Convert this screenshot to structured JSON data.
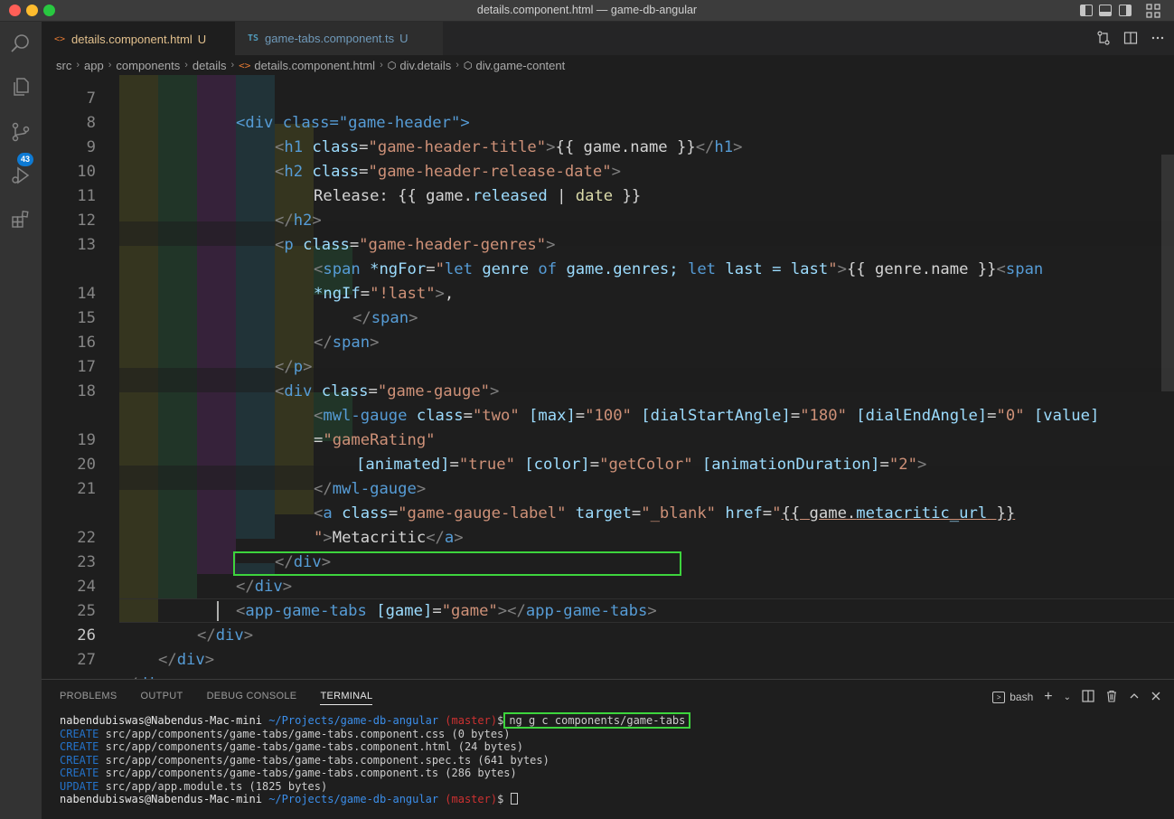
{
  "window": {
    "title": "details.component.html — game-db-angular"
  },
  "activity": {
    "scm_badge": "43"
  },
  "tabs": [
    {
      "icon": "<>",
      "label": "details.component.html",
      "status": "U"
    },
    {
      "icon": "TS",
      "label": "game-tabs.component.ts",
      "status": "U"
    }
  ],
  "breadcrumb": [
    "src",
    "app",
    "components",
    "details",
    "details.component.html",
    "div.details",
    "div.game-content"
  ],
  "editor": {
    "lines": [
      {
        "n": "7"
      },
      {
        "n": "8"
      },
      {
        "n": "9"
      },
      {
        "n": "10"
      },
      {
        "n": "11"
      },
      {
        "n": "12"
      },
      {
        "n": "13"
      },
      {
        "n": ""
      },
      {
        "n": "14"
      },
      {
        "n": "15"
      },
      {
        "n": "16"
      },
      {
        "n": "17"
      },
      {
        "n": "18"
      },
      {
        "n": ""
      },
      {
        "n": "19"
      },
      {
        "n": "20"
      },
      {
        "n": "21"
      },
      {
        "n": ""
      },
      {
        "n": "22"
      },
      {
        "n": "23"
      },
      {
        "n": "24"
      },
      {
        "n": "25"
      },
      {
        "n": "26"
      },
      {
        "n": "27"
      }
    ],
    "tokens": {
      "l7": [
        "<div class=\"game-header\">"
      ],
      "l8": [
        "<",
        "h1",
        " class",
        "=",
        "\"game-header-title\"",
        ">",
        "{{ game.name }}",
        "</",
        "h1",
        ">"
      ],
      "l9": [
        "<",
        "h2",
        " class",
        "=",
        "\"game-header-release-date\"",
        ">"
      ],
      "l10": [
        "Release: {{ game.",
        "released",
        " | ",
        "date",
        " }}"
      ],
      "l11": [
        "</",
        "h2",
        ">"
      ],
      "l12": [
        "<",
        "p",
        " class",
        "=",
        "\"game-header-genres\"",
        ">"
      ],
      "l13": [
        "<",
        "span",
        " *ngFor",
        "=",
        "\"",
        "let",
        " genre ",
        "of",
        " game.genres; ",
        "let",
        " last = last",
        "\"",
        ">",
        "{{ genre.name }}",
        "<",
        "span"
      ],
      "l13b": [
        "*ngIf",
        "=",
        "\"!last\"",
        ">",
        ","
      ],
      "l14": [
        "</",
        "span",
        ">"
      ],
      "l15": [
        "</",
        "span",
        ">"
      ],
      "l16": [
        "</",
        "p",
        ">"
      ],
      "l17": [
        "<",
        "div",
        " class",
        "=",
        "\"game-gauge\"",
        ">"
      ],
      "l18": [
        "<",
        "mwl-gauge",
        " class",
        "=",
        "\"two\"",
        " [max]",
        "=",
        "\"100\"",
        " [dialStartAngle]",
        "=",
        "\"180\"",
        " [dialEndAngle]",
        "=",
        "\"0\"",
        " [value]"
      ],
      "l18b": [
        "=",
        "\"gameRating\""
      ],
      "l19": [
        "[animated]",
        "=",
        "\"true\"",
        " [color]",
        "=",
        "\"getColor\"",
        " [animationDuration]",
        "=",
        "\"2\"",
        ">"
      ],
      "l20": [
        "</",
        "mwl-gauge",
        ">"
      ],
      "l21": [
        "<",
        "a",
        " class",
        "=",
        "\"game-gauge-label\"",
        " target",
        "=",
        "\"_blank\"",
        " href",
        "=",
        "\"",
        "{{ game.",
        "metacritic_url",
        " }}"
      ],
      "l21b": [
        "\"",
        ">",
        "Metacritic",
        "</",
        "a",
        ">"
      ],
      "l22": [
        "</",
        "div",
        ">"
      ],
      "l23": [
        "</",
        "div",
        ">"
      ],
      "l24": [
        "<",
        "app-game-tabs",
        " [game]",
        "=",
        "\"game\"",
        "></",
        "app-game-tabs",
        ">"
      ],
      "l25": [
        "</",
        "div",
        ">"
      ],
      "l26": [
        "</",
        "div",
        ">"
      ],
      "l27": [
        "</",
        "div",
        ">"
      ]
    }
  },
  "panel": {
    "tabs": [
      "PROBLEMS",
      "OUTPUT",
      "DEBUG CONSOLE",
      "TERMINAL"
    ],
    "shell": "bash",
    "terminal": {
      "user": "nabendubiswas@Nabendus-Mac-mini",
      "path": "~/Projects/game-db-angular",
      "branch": "(master)",
      "prompt_end": "$",
      "command": "ng g c components/game-tabs",
      "output": [
        {
          "action": "CREATE",
          "text": " src/app/components/game-tabs/game-tabs.component.css (0 bytes)"
        },
        {
          "action": "CREATE",
          "text": " src/app/components/game-tabs/game-tabs.component.html (24 bytes)"
        },
        {
          "action": "CREATE",
          "text": " src/app/components/game-tabs/game-tabs.component.spec.ts (641 bytes)"
        },
        {
          "action": "CREATE",
          "text": " src/app/components/game-tabs/game-tabs.component.ts (286 bytes)"
        },
        {
          "action": "UPDATE",
          "text": " src/app/app.module.ts (1825 bytes)"
        }
      ]
    }
  }
}
